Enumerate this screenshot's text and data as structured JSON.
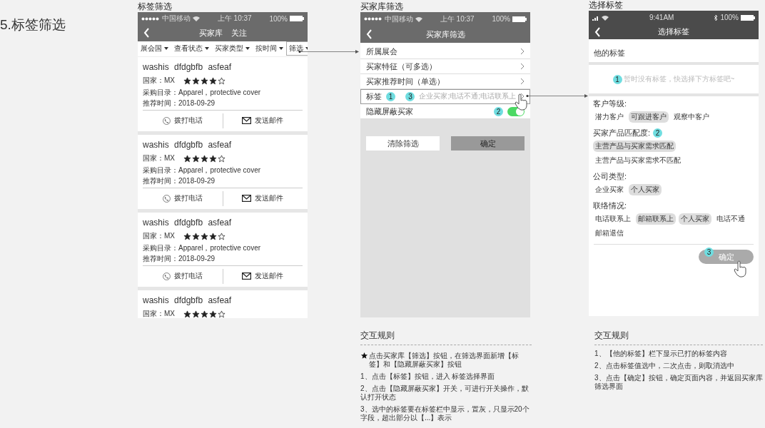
{
  "page_title": "5.标签筛选",
  "list_screen": {
    "caption": "标签筛选",
    "status_bar": {
      "carrier": "中国移动",
      "time": "上午 10:37",
      "battery": "100%"
    },
    "nav_items": [
      "买家库",
      "关注"
    ],
    "filters": [
      {
        "label": "展会国",
        "selected": false
      },
      {
        "label": "查看状态",
        "selected": false
      },
      {
        "label": "买家类型",
        "selected": false
      },
      {
        "label": "按时间",
        "selected": false
      },
      {
        "label": "筛选",
        "selected": true
      }
    ],
    "cards": [
      {
        "name": "washis dfdgbfb asfeaf",
        "country": "国家：MX",
        "stars": 4,
        "catalog": "采购目录：Apparel，protective cover",
        "date": "推荐时间：2018-09-29",
        "actions": [
          {
            "label": "拨打电话",
            "kind": "call"
          },
          {
            "label": "发送邮件",
            "kind": "email"
          }
        ]
      },
      {
        "name": "washis dfdgbfb asfeaf",
        "country": "国家：MX",
        "stars": 4,
        "catalog": "采购目录：Apparel，protective cover",
        "date": "推荐时间：2018-09-29",
        "actions": [
          {
            "label": "拨打电话",
            "kind": "call"
          },
          {
            "label": "发送邮件",
            "kind": "email"
          }
        ]
      },
      {
        "name": "washis dfdgbfb asfeaf",
        "country": "国家：MX",
        "stars": 4,
        "catalog": "采购目录：Apparel，protective cover",
        "date": "推荐时间：2018-09-29",
        "actions": [
          {
            "label": "拨打电话",
            "kind": "call"
          },
          {
            "label": "发送邮件",
            "kind": "email"
          }
        ]
      },
      {
        "name": "washis dfdgbfb asfeaf",
        "country": "国家：MX",
        "stars": 4
      }
    ]
  },
  "filter_screen": {
    "caption": "买家库筛选",
    "status_bar": {
      "carrier": "中国移动",
      "time": "上午 10:37",
      "battery": "100%"
    },
    "title": "买家库筛选",
    "rows": [
      {
        "label": "所属展会",
        "kind": "link"
      },
      {
        "label": "买家特征（可多选）",
        "kind": "link"
      },
      {
        "label": "买家推荐时间（单选）",
        "kind": "link"
      },
      {
        "label": "标签",
        "kind": "tags",
        "badge": "1",
        "value_badge": "3",
        "value": "企业买家;电话不通;电话联系上"
      },
      {
        "label": "隐藏屏蔽买家",
        "kind": "toggle",
        "badge": "2",
        "on": true
      }
    ],
    "buttons": [
      {
        "label": "清除筛选",
        "kind": "secondary"
      },
      {
        "label": "确定",
        "kind": "primary"
      }
    ]
  },
  "tag_screen": {
    "caption": "选择标签",
    "status_bar": {
      "time": "9:41AM",
      "battery": "100%"
    },
    "title": "选择标签",
    "my_tags_title": "他的标签",
    "my_tags_badge": "1",
    "my_tags_placeholder": "暂时没有标签，快选择下方标签吧~",
    "groups": [
      {
        "title": "客户等级:",
        "tags": [
          {
            "label": "潜力客户",
            "selected": false
          },
          {
            "label": "可跟进客户",
            "selected": true
          },
          {
            "label": "观察中客户",
            "selected": false
          }
        ]
      },
      {
        "title": "买家产品匹配度:",
        "badge": "2",
        "tags": [
          {
            "label": "主营产品与买家需求匹配",
            "selected": true
          },
          {
            "label": "主营产品与买家需求不匹配",
            "selected": false
          }
        ]
      },
      {
        "title": "公司类型:",
        "tags": [
          {
            "label": "企业买家",
            "selected": false
          },
          {
            "label": "个人买家",
            "selected": true
          }
        ]
      },
      {
        "title": "联络情况:",
        "tags": [
          {
            "label": "电话联系上",
            "selected": false
          },
          {
            "label": "邮箱联系上",
            "selected": true
          },
          {
            "label": "个人买家",
            "selected": true
          },
          {
            "label": "电话不通",
            "selected": false
          },
          {
            "label": "邮箱退信",
            "selected": false
          }
        ]
      }
    ],
    "confirm": {
      "label": "确定",
      "badge": "3"
    }
  },
  "filter_rules": {
    "title": "交互规则",
    "items": [
      {
        "kind": "star",
        "text": "点击买家库【筛选】按钮，在筛选界面新增【标签】和【隐藏屏蔽买家】按钮"
      },
      {
        "kind": "plain",
        "text": "1、点击【标签】按钮，进入 标签选择界面"
      },
      {
        "kind": "plain",
        "text": "2、点击【隐藏屏蔽买家】开关，可进行开关操作，默认打开状态"
      },
      {
        "kind": "plain",
        "text": "3、选中的标签要在标签栏中显示，置灰，只显示20个字段，超出部分以【...】表示"
      }
    ]
  },
  "tag_rules": {
    "title": "交互规则",
    "items": [
      {
        "kind": "plain",
        "text": "1、【他的标签】栏下显示已打的标签内容"
      },
      {
        "kind": "plain",
        "text": "2、点击标签值选中，二次点击，则取消选中"
      },
      {
        "kind": "plain",
        "text": "3、点击【确定】按钮，确定页面内容，并返回买家库筛选界面"
      }
    ]
  }
}
